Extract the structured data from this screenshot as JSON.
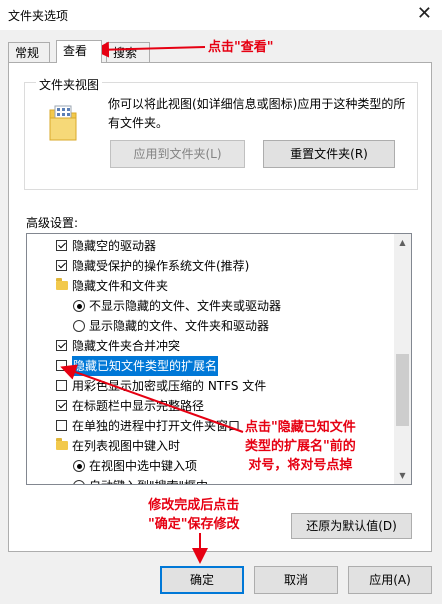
{
  "window": {
    "title": "文件夹选项",
    "close_glyph": "✕"
  },
  "tabs": [
    {
      "label": "常规",
      "active": false
    },
    {
      "label": "查看",
      "active": true
    },
    {
      "label": "搜索",
      "active": false
    }
  ],
  "folder_views": {
    "title": "文件夹视图",
    "description": "你可以将此视图(如详细信息或图标)应用于这种类型的所有文件夹。",
    "apply_button": "应用到文件夹(L)",
    "reset_button": "重置文件夹(R)"
  },
  "advanced": {
    "label": "高级设置:",
    "items": [
      {
        "type": "checkbox",
        "checked": true,
        "indent": 1,
        "text": "隐藏空的驱动器"
      },
      {
        "type": "checkbox",
        "checked": true,
        "indent": 1,
        "text": "隐藏受保护的操作系统文件(推荐)"
      },
      {
        "type": "folder",
        "indent": 1,
        "text": "隐藏文件和文件夹"
      },
      {
        "type": "radio",
        "checked": true,
        "indent": 2,
        "text": "不显示隐藏的文件、文件夹或驱动器"
      },
      {
        "type": "radio",
        "checked": false,
        "indent": 2,
        "text": "显示隐藏的文件、文件夹和驱动器"
      },
      {
        "type": "checkbox",
        "checked": true,
        "indent": 1,
        "text": "隐藏文件夹合并冲突"
      },
      {
        "type": "checkbox",
        "checked": false,
        "indent": 1,
        "text": "隐藏已知文件类型的扩展名",
        "selected": true
      },
      {
        "type": "checkbox",
        "checked": false,
        "indent": 1,
        "text": "用彩色显示加密或压缩的 NTFS 文件"
      },
      {
        "type": "checkbox",
        "checked": true,
        "indent": 1,
        "text": "在标题栏中显示完整路径"
      },
      {
        "type": "checkbox",
        "checked": false,
        "indent": 1,
        "text": "在单独的进程中打开文件夹窗口"
      },
      {
        "type": "folder",
        "indent": 1,
        "text": "在列表视图中键入时"
      },
      {
        "type": "radio",
        "checked": true,
        "indent": 2,
        "text": "在视图中选中键入项"
      },
      {
        "type": "radio",
        "checked": false,
        "indent": 2,
        "text": "自动键入到\"搜索\"框中"
      }
    ]
  },
  "buttons": {
    "restore_defaults": "还原为默认值(D)",
    "ok": "确定",
    "cancel": "取消",
    "apply": "应用(A)"
  },
  "annotations": {
    "tab_note": "点击\"查看\"",
    "ext_note_lines": [
      "点击\"隐藏已知文件",
      "类型的扩展名\"前的",
      "对号，将对号点掉"
    ],
    "ok_note_lines": [
      "修改完成后点击",
      "\"确定\"保存修改"
    ],
    "color": "#e60012"
  },
  "colors": {
    "selection": "#0078d7",
    "primary_border": "#0078d7"
  }
}
